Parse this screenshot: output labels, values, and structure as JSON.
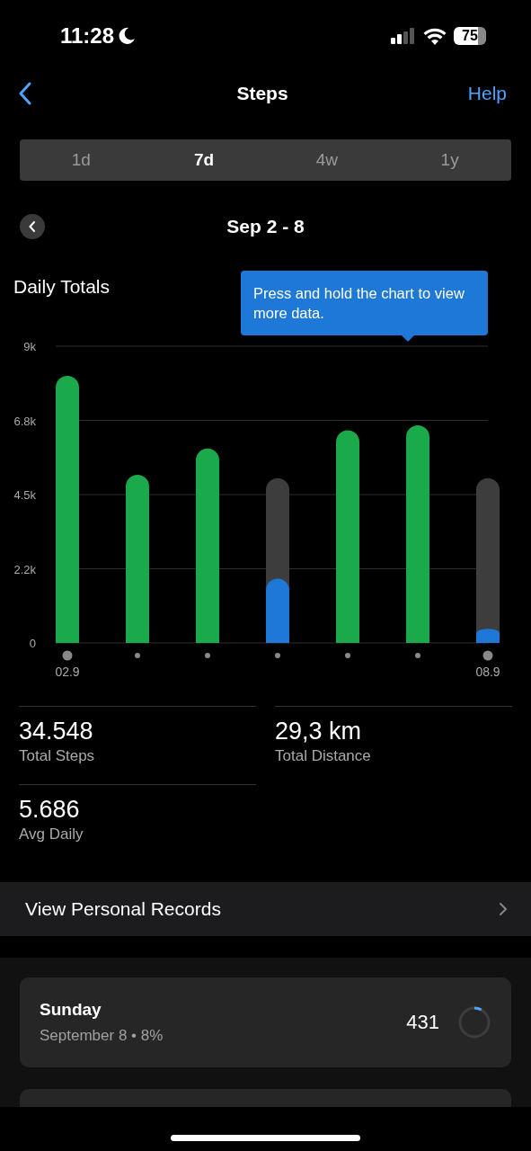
{
  "status_bar": {
    "time": "11:28",
    "battery": "75"
  },
  "nav": {
    "title": "Steps",
    "action": "Help"
  },
  "tabs": [
    {
      "label": "1d",
      "selected": false
    },
    {
      "label": "7d",
      "selected": true
    },
    {
      "label": "4w",
      "selected": false
    },
    {
      "label": "1y",
      "selected": false
    }
  ],
  "period": {
    "label": "Sep 2 - 8"
  },
  "chart_section": {
    "title": "Daily Totals",
    "tooltip": "Press and hold the chart to view more data.",
    "x_labels": [
      "02.9",
      "08.9"
    ],
    "chart_data": {
      "type": "bar",
      "grid": true,
      "ylim": [
        0,
        9000
      ],
      "yticks": [
        {
          "value": 0,
          "label": "0"
        },
        {
          "value": 2250,
          "label": "2.2k"
        },
        {
          "value": 4500,
          "label": "4.5k"
        },
        {
          "value": 6750,
          "label": "6.8k"
        },
        {
          "value": 9000,
          "label": "9k"
        }
      ],
      "series": [
        {
          "color": "#3d3d3d",
          "values": [
            null,
            null,
            null,
            5000,
            null,
            null,
            5000
          ]
        },
        {
          "color": "#1aaa4b",
          "values": [
            8100,
            5100,
            5900,
            null,
            6450,
            6600,
            null
          ]
        },
        {
          "color": "#1e78d8",
          "values": [
            null,
            null,
            null,
            1950,
            null,
            null,
            430
          ]
        }
      ]
    }
  },
  "stats": [
    {
      "value": "34.548",
      "label": "Total Steps"
    },
    {
      "value": "29,3 km",
      "label": "Total Distance"
    },
    {
      "value": "5.686",
      "label": "Avg Daily"
    }
  ],
  "records_link": {
    "label": "View Personal Records"
  },
  "days": [
    {
      "day": "Sunday",
      "detail": "September 8 • 8%",
      "steps": "431",
      "level": 0.08
    }
  ]
}
